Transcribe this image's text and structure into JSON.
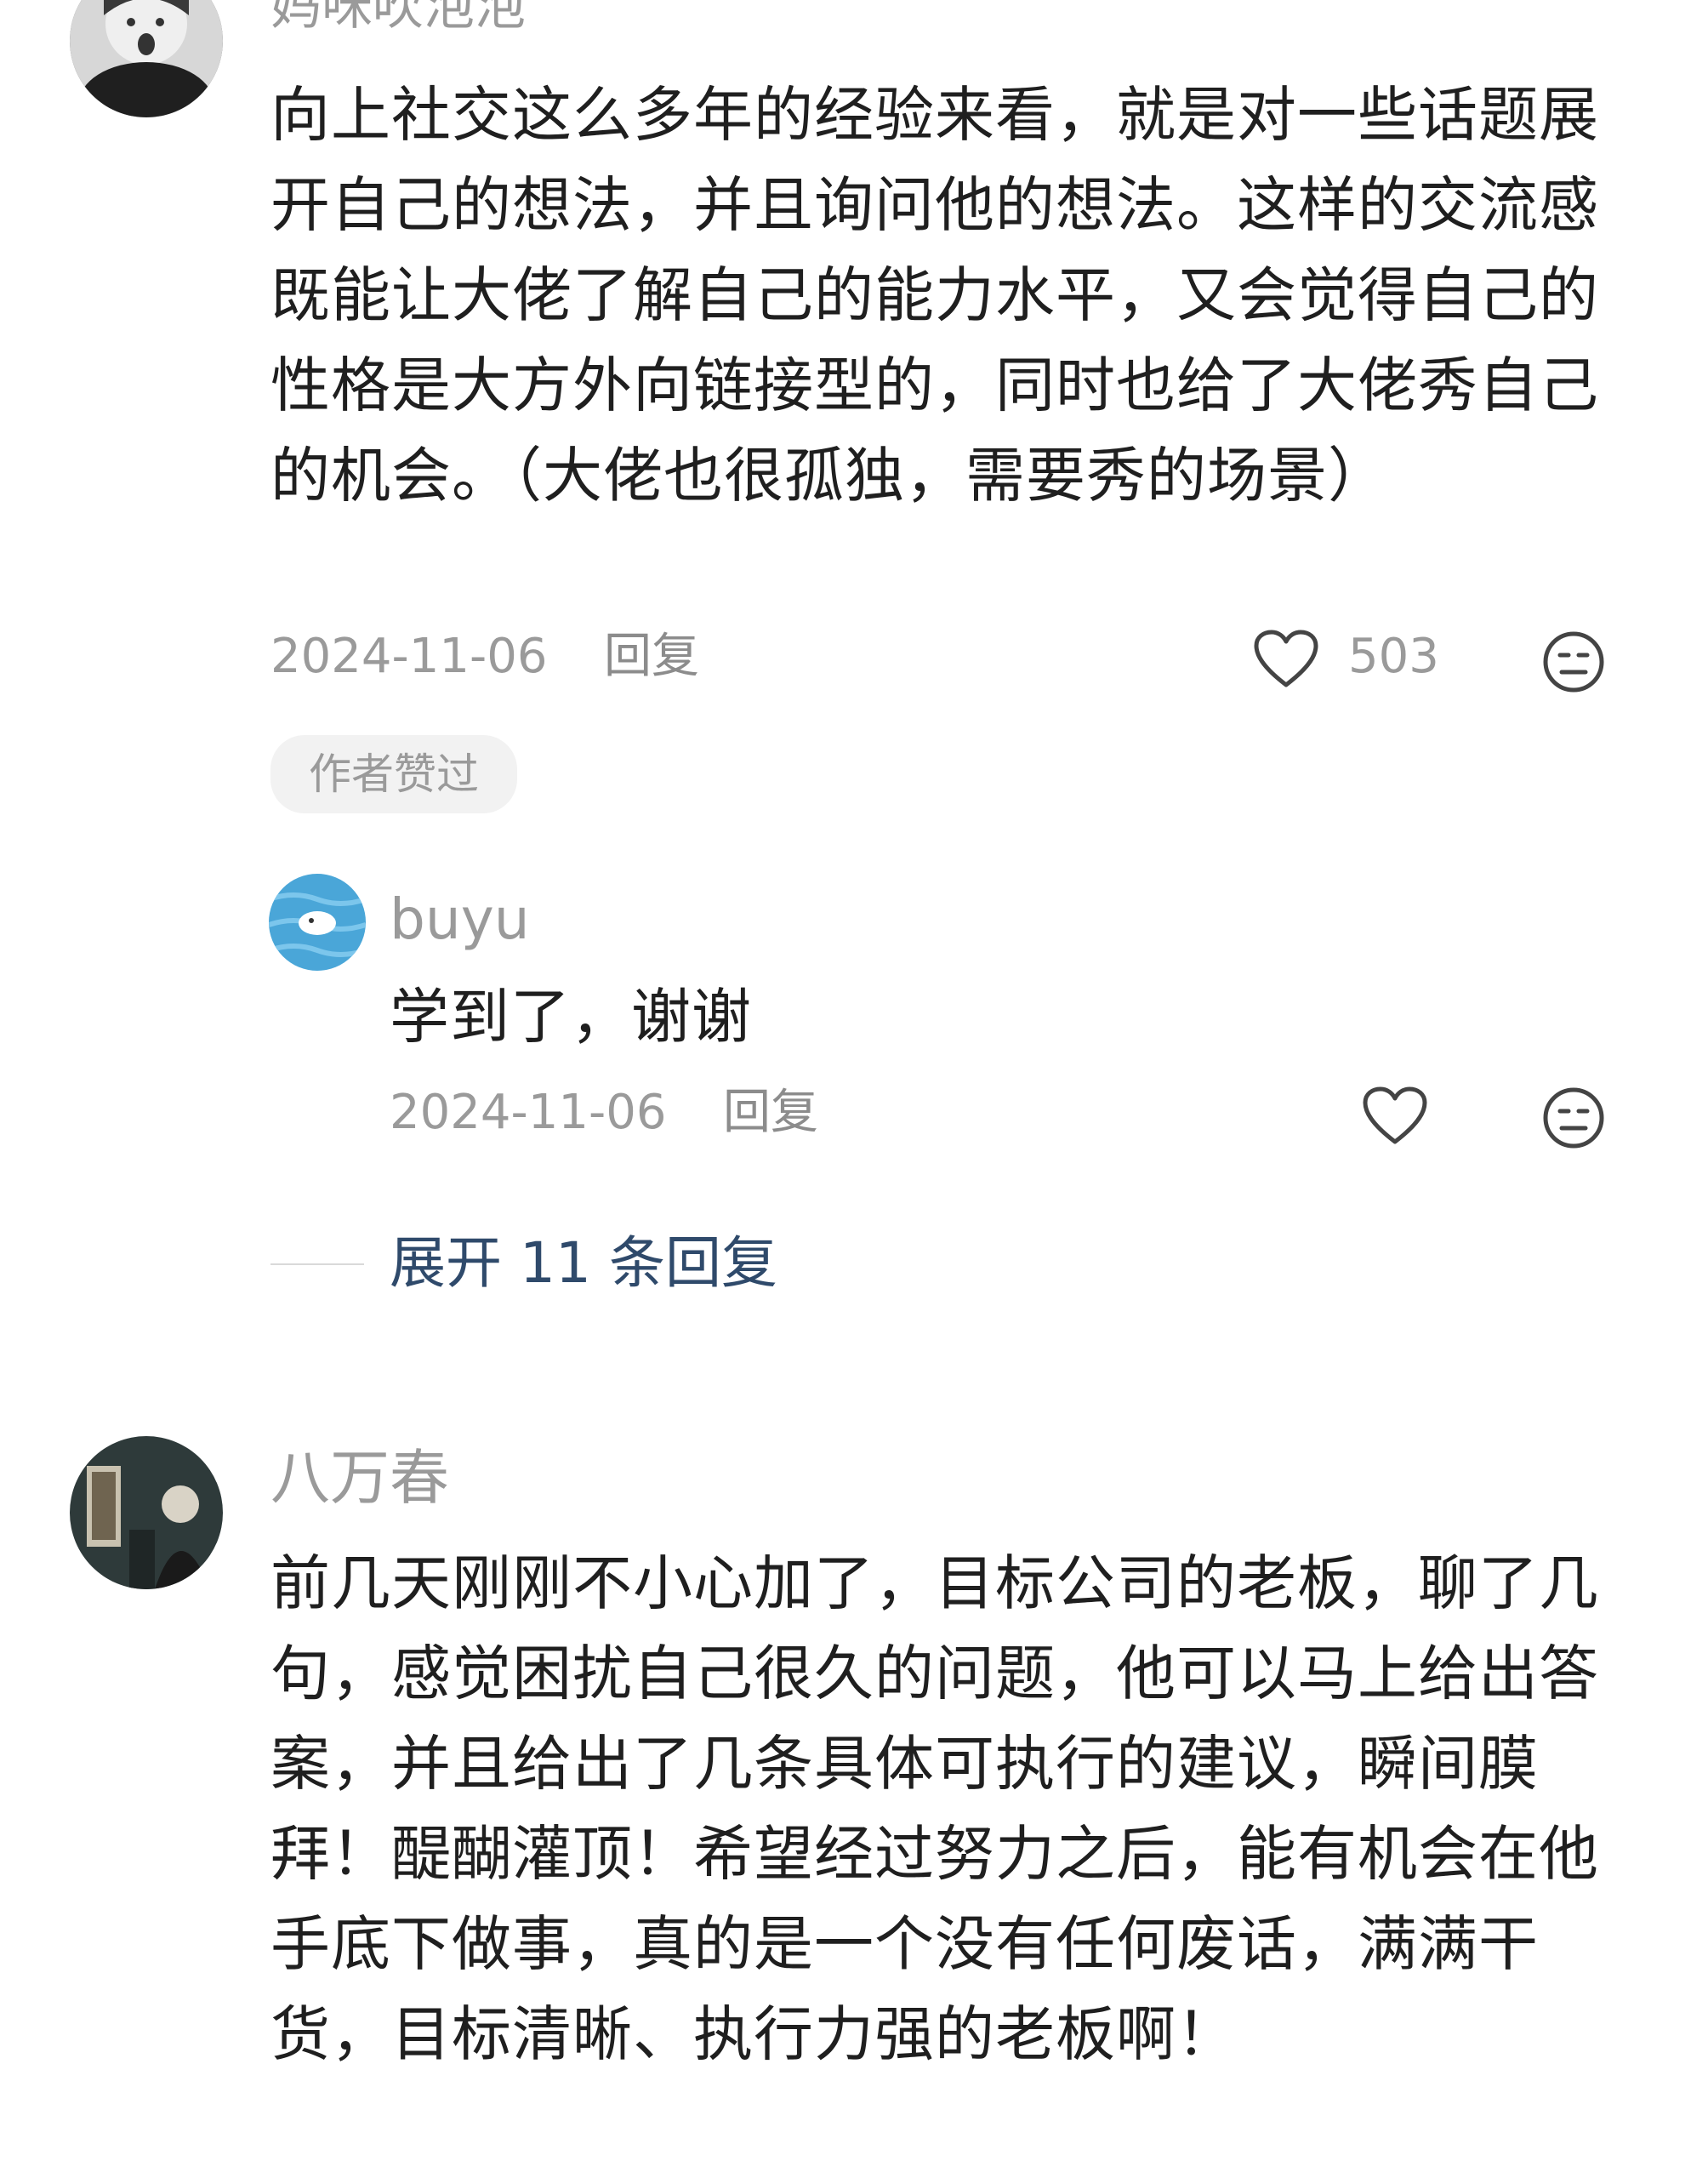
{
  "comments": [
    {
      "author": "妈咪吹泡泡",
      "body": "向上社交这么多年的经验来看，就是对一些话题展开自己的想法，并且询问他的想法。这样的交流感既能让大佬了解自己的能力水平，又会觉得自己的性格是大方外向链接型的，同时也给了大佬秀自己的机会。（大佬也很孤独，需要秀的场景）",
      "date": "2024-11-06",
      "reply_label": "回复",
      "like_count": "503",
      "badge": "作者赞过",
      "replies": [
        {
          "author": "buyu",
          "body": "学到了，谢谢",
          "date": "2024-11-06",
          "reply_label": "回复"
        }
      ],
      "expand_label": "展开 11 条回复"
    },
    {
      "author": "八万春",
      "body": "前几天刚刚不小心加了，目标公司的老板，聊了几句，感觉困扰自己很久的问题，他可以马上给出答案，并且给出了几条具体可执行的建议，瞬间膜拜！醍醐灌顶！希望经过努力之后，能有机会在他手底下做事，真的是一个没有任何废话，满满干货，目标清晰、执行力强的老板啊！"
    }
  ],
  "icons": {
    "like": "heart-outline-icon",
    "dislike": "meh-face-icon"
  }
}
